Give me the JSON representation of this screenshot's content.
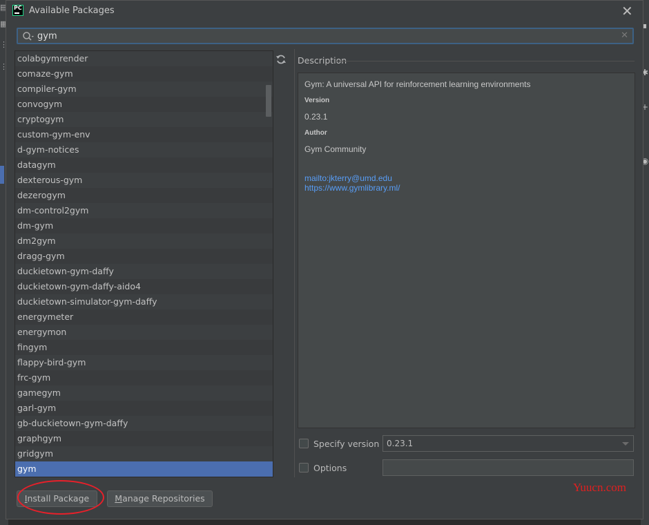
{
  "window": {
    "title": "Available Packages",
    "icon_text": "PC",
    "accent": "#4b6eaf"
  },
  "search": {
    "value": "gym",
    "placeholder": ""
  },
  "packages": [
    "colabgymrender",
    "comaze-gym",
    "compiler-gym",
    "convogym",
    "cryptogym",
    "custom-gym-env",
    "d-gym-notices",
    "datagym",
    "dexterous-gym",
    "dezerogym",
    "dm-control2gym",
    "dm-gym",
    "dm2gym",
    "dragg-gym",
    "duckietown-gym-daffy",
    "duckietown-gym-daffy-aido4",
    "duckietown-simulator-gym-daffy",
    "energymeter",
    "energymon",
    "fingym",
    "flappy-bird-gym",
    "frc-gym",
    "gamegym",
    "garl-gym",
    "gb-duckietown-gym-daffy",
    "graphgym",
    "gridgym",
    "gym"
  ],
  "selected_index": 27,
  "description": {
    "label": "Description",
    "summary": "Gym: A universal API for reinforcement learning environments",
    "version_heading": "Version",
    "version": "0.23.1",
    "author_heading": "Author",
    "author": "Gym Community",
    "email_link": "mailto:jkterry@umd.edu",
    "homepage_link": "https://www.gymlibrary.ml/"
  },
  "specify_version": {
    "label": "Specify version",
    "checked": false,
    "selected": "0.23.1"
  },
  "options": {
    "label": "Options",
    "checked": false,
    "value": ""
  },
  "buttons": {
    "install_pre": "I",
    "install_rest": "nstall Package",
    "manage_pre": "M",
    "manage_rest": "anage Repositories"
  },
  "watermark": "Yuucn.com",
  "annotation_color": "#e8202a"
}
